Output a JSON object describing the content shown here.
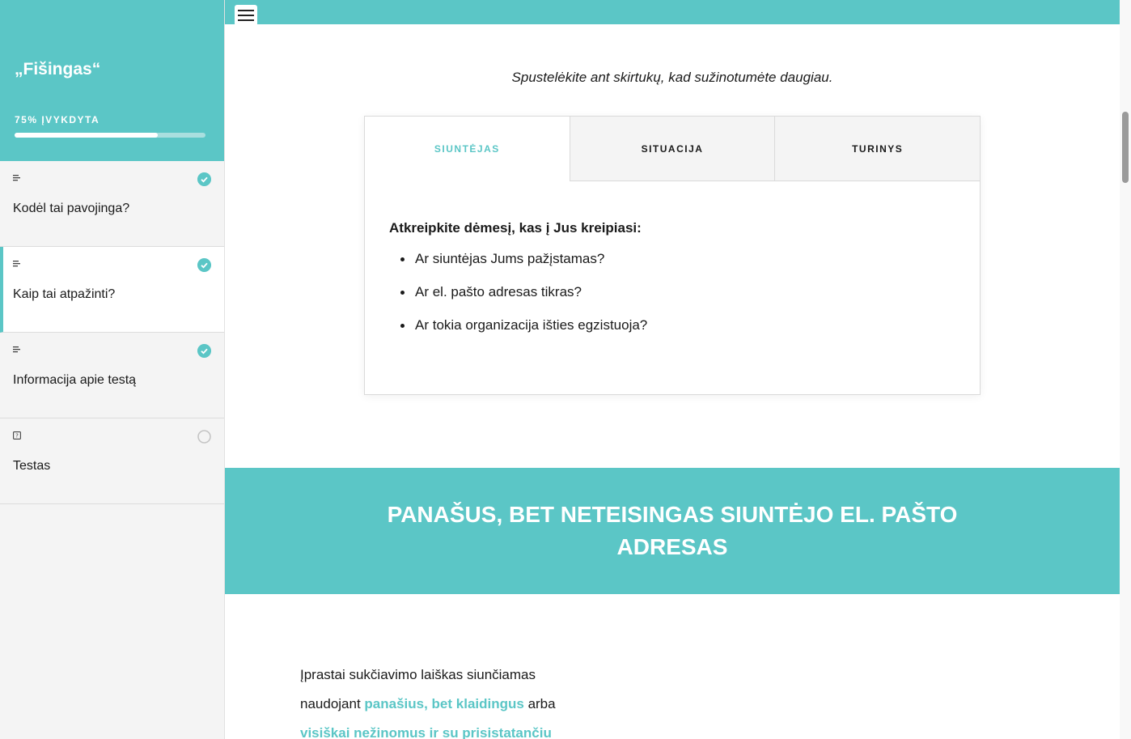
{
  "sidebar": {
    "course_title": "„Fišingas“",
    "progress_label": "75% ĮVYKDYTA",
    "progress_value": 0.75,
    "lessons": [
      {
        "title": "Kodėl tai pavojinga?",
        "type_icon": "text-lines-icon",
        "status": "completed",
        "active": false
      },
      {
        "title": "Kaip tai atpažinti?",
        "type_icon": "text-lines-icon",
        "status": "completed",
        "active": true
      },
      {
        "title": "Informacija apie testą",
        "type_icon": "text-lines-icon",
        "status": "completed",
        "active": false
      },
      {
        "title": "Testas",
        "type_icon": "quiz-icon",
        "status": "incomplete",
        "active": false
      }
    ]
  },
  "main": {
    "menu_icon": "hamburger-menu-icon",
    "instruction": "Spustelėkite ant skirtukų, kad sužinotumėte daugiau.",
    "tabs": [
      {
        "label": "SIUNTĖJAS",
        "active": true
      },
      {
        "label": "SITUACIJA",
        "active": false
      },
      {
        "label": "TURINYS",
        "active": false
      }
    ],
    "panel": {
      "heading": "Atkreipkite dėmesį, kas į Jus kreipiasi:",
      "items": [
        "Ar siuntėjas Jums pažįstamas?",
        "Ar el. pašto adresas tikras?",
        "Ar tokia organizacija išties egzistuoja?"
      ]
    },
    "banner_title": "PANAŠUS, BET NETEISINGAS SIUNTĖJO EL. PAŠTO ADRESAS",
    "body": {
      "line1": "Įprastai sukčiavimo laiškas siunčiamas",
      "line2_prefix": "naudojant ",
      "line2_highlight": "panašius, bet klaidingus",
      "line2_suffix": " arba",
      "line3_highlight": "visiškai nežinomus ir su prisistatančiu"
    }
  },
  "colors": {
    "accent": "#5bc6c6",
    "sidebar_bg": "#f4f4f4",
    "text": "#1a1a1a"
  }
}
